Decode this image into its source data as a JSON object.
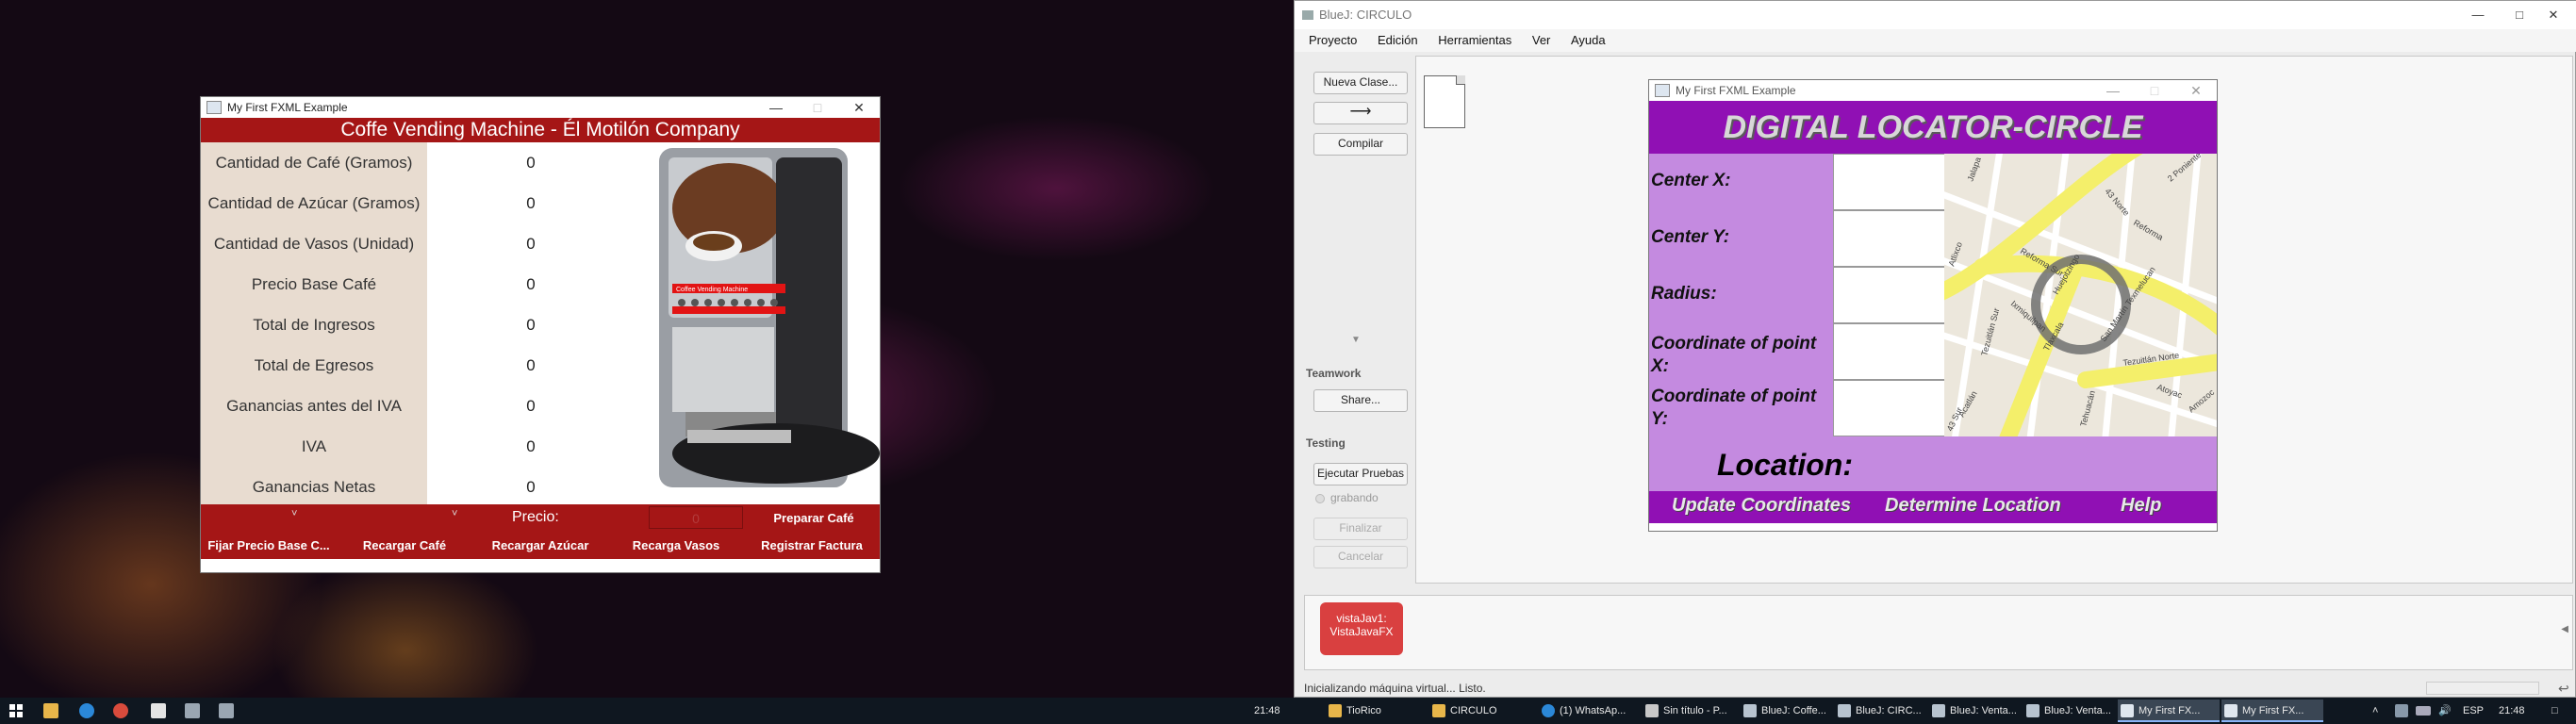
{
  "coffee_window": {
    "title": "My First FXML Example",
    "banner": "Coffe Vending Machine  -  Él Motilón Company",
    "rows": [
      {
        "label": "Cantidad de Café (Gramos)",
        "value": "0"
      },
      {
        "label": "Cantidad de Azúcar (Gramos)",
        "value": "0"
      },
      {
        "label": "Cantidad de Vasos (Unidad)",
        "value": "0"
      },
      {
        "label": "Precio Base Café",
        "value": "0"
      },
      {
        "label": "Total de Ingresos",
        "value": "0"
      },
      {
        "label": "Total de Egresos",
        "value": "0"
      },
      {
        "label": "Ganancias antes del IVA",
        "value": "0"
      },
      {
        "label": "IVA",
        "value": "0"
      },
      {
        "label": "Ganancias Netas",
        "value": "0"
      }
    ],
    "price_label": "Precio:",
    "price_value": "0",
    "buttons": {
      "preparar": "Preparar Café",
      "fijar": "Fijar Precio Base C...",
      "recargar_cafe": "Recargar Café",
      "recargar_azucar": "Recargar Azúcar",
      "recarga_vasos": "Recarga Vasos",
      "registrar": "Registrar Factura"
    },
    "machine_label": "Coffee Vending Machine"
  },
  "bluej": {
    "title": "BlueJ: CIRCULO",
    "menu": [
      "Proyecto",
      "Edición",
      "Herramientas",
      "Ver",
      "Ayuda"
    ],
    "buttons": {
      "nueva_clase": "Nueva Clase...",
      "compilar": "Compilar"
    },
    "teamwork_label": "Teamwork",
    "share": "Share...",
    "testing_label": "Testing",
    "ejecutar": "Ejecutar Pruebas",
    "grabando": "grabando",
    "finalizar": "Finalizar",
    "cancelar": "Cancelar",
    "object": {
      "line1": "vistaJav1:",
      "line2": "VistaJavaFX"
    },
    "status": "Inicializando máquina virtual... Listo."
  },
  "locator": {
    "title": "My First FXML Example",
    "banner": "DIGITAL LOCATOR-CIRCLE",
    "labels": {
      "cx": "Center X:",
      "cy": "Center Y:",
      "radius": "Radius:",
      "px_1": "Coordinate of point",
      "px_2": "X:",
      "py_1": "Coordinate of point",
      "py_2": "Y:"
    },
    "location_label": "Location:",
    "buttons": {
      "update": "Update Coordinates",
      "determine": "Determine Location",
      "help": "Help"
    },
    "map_labels": [
      "Jalapa",
      "43 Norte",
      "Reforma",
      "2 Poniente",
      "Reforma Sur",
      "Tezuitlán Sur",
      "Atlixco",
      "Tlaxcala",
      "San Martín Texmelucan",
      "Tezuitlán Norte",
      "Huejotzingo",
      "Ixmiquilpan",
      "Acatlán",
      "Atoyac",
      "Amozoc",
      "43 Sur",
      "Tehuacán"
    ]
  },
  "taskbar": {
    "clock_left": "21:48",
    "clock_right": "21:48",
    "lang": "ESP",
    "tasks": [
      "TioRico",
      "CIRCULO",
      "(1) WhatsAp...",
      "Sin título - P...",
      "BlueJ: Coffe...",
      "BlueJ: CIRC...",
      "BlueJ: Venta...",
      "BlueJ: Venta...",
      "My First FX...",
      "My First FX..."
    ],
    "colors": {
      "active": "#3a4654",
      "bar": "#0f1720"
    }
  }
}
